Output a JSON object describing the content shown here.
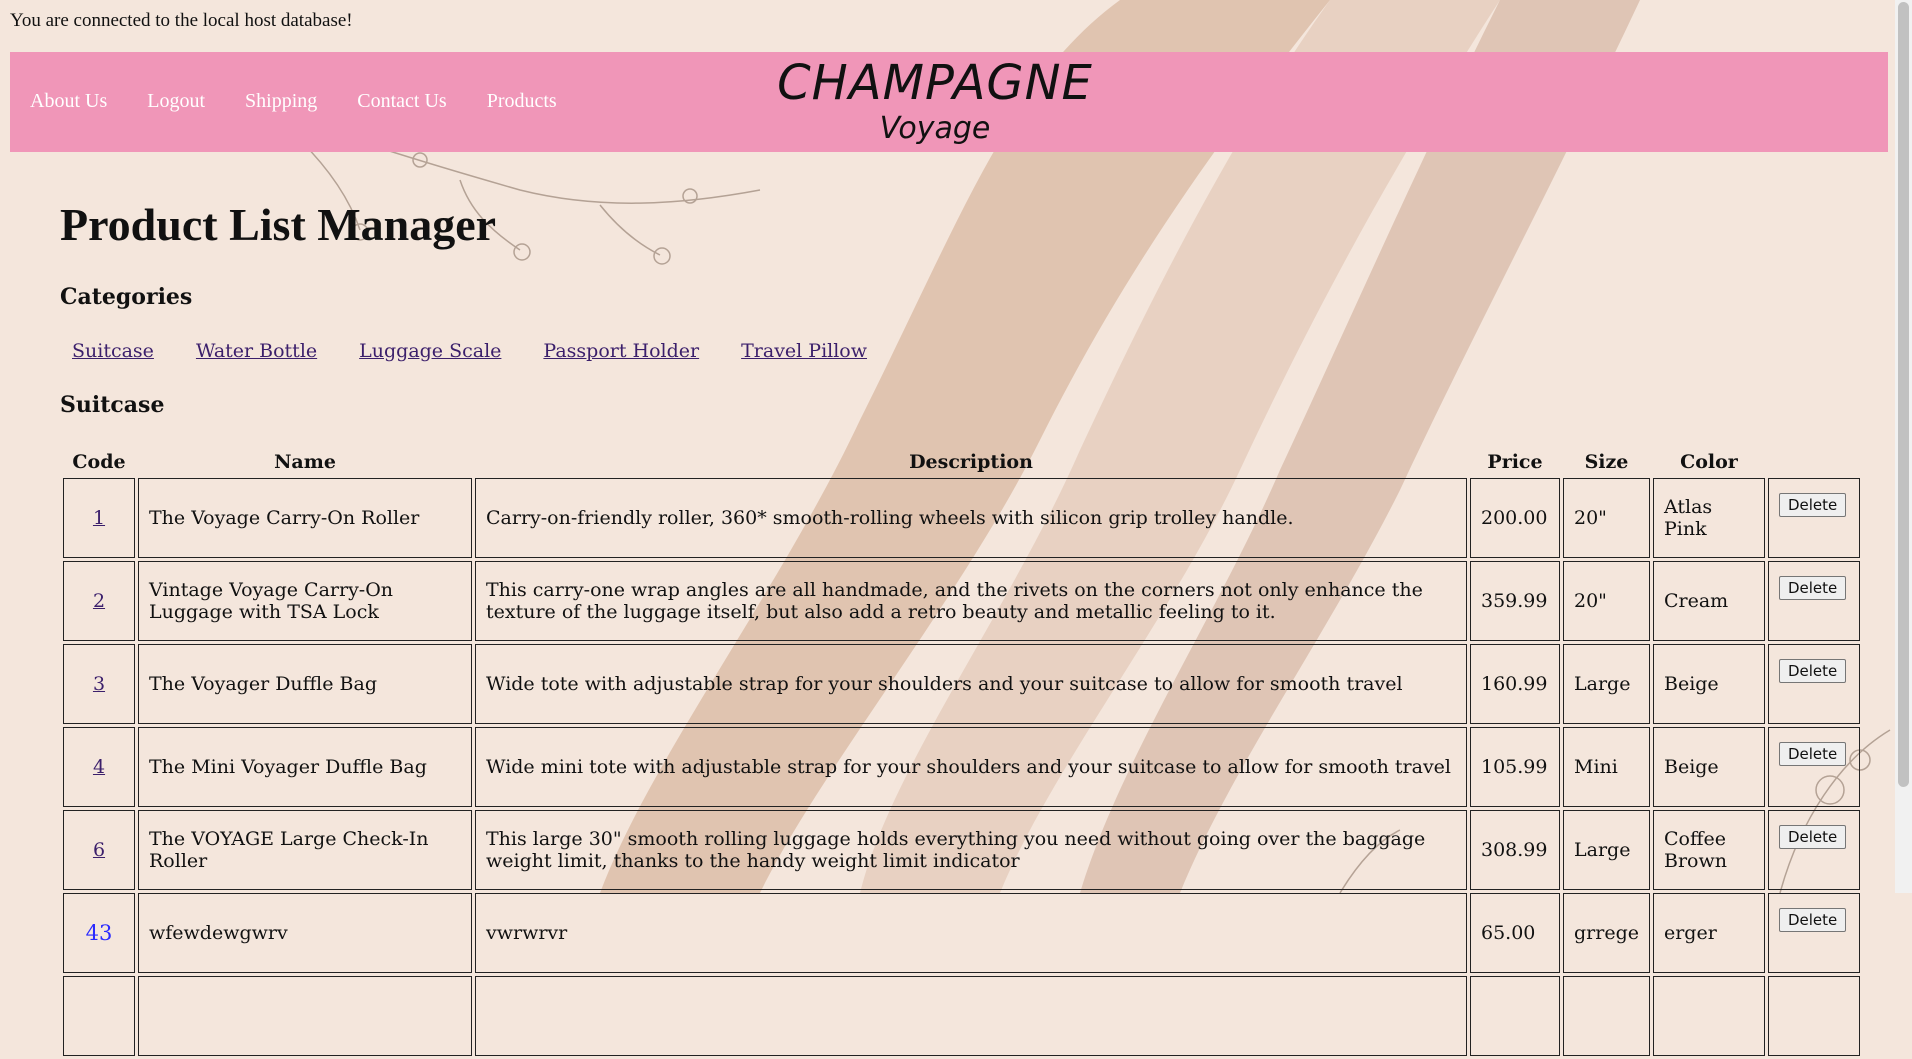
{
  "connection_message": "You are connected to the local host database!",
  "header": {
    "nav": [
      "About Us",
      "Logout",
      "Shipping",
      "Contact Us",
      "Products"
    ],
    "logo_main": "CHAMPAGNE",
    "logo_sub": "Voyage"
  },
  "page_title": "Product List Manager",
  "categories_heading": "Categories",
  "categories": [
    "Suitcase",
    "Water Bottle",
    "Luggage Scale",
    "Passport Holder",
    "Travel Pillow"
  ],
  "selected_category": "Suitcase",
  "table": {
    "headers": [
      "Code",
      "Name",
      "Description",
      "Price",
      "Size",
      "Color"
    ],
    "delete_label": "Delete",
    "rows": [
      {
        "code": "1",
        "name": "The Voyage Carry-On Roller",
        "description": "Carry-on-friendly roller, 360* smooth-rolling wheels with silicon grip trolley handle.",
        "price": "200.00",
        "size": "20\"",
        "color": "Atlas Pink"
      },
      {
        "code": "2",
        "name": "Vintage Voyage Carry-On Luggage with TSA Lock",
        "description": "This carry-one wrap angles are all handmade, and the rivets on the corners not only enhance the texture of the luggage itself, but also add a retro beauty and metallic feeling to it.",
        "price": "359.99",
        "size": "20\"",
        "color": "Cream"
      },
      {
        "code": "3",
        "name": "The Voyager Duffle Bag",
        "description": "Wide tote with adjustable strap for your shoulders and your suitcase to allow for smooth travel",
        "price": "160.99",
        "size": "Large",
        "color": "Beige"
      },
      {
        "code": "4",
        "name": "The Mini Voyager Duffle Bag",
        "description": "Wide mini tote with adjustable strap for your shoulders and your suitcase to allow for smooth travel",
        "price": "105.99",
        "size": "Mini",
        "color": "Beige"
      },
      {
        "code": "6",
        "name": "The VOYAGE Large Check-In Roller",
        "description": "This large 30\" smooth rolling luggage holds everything you need without going over the baggage weight limit, thanks to the handy weight limit indicator",
        "price": "308.99",
        "size": "Large",
        "color": "Coffee Brown"
      },
      {
        "code": "43",
        "name": "wfewdewgwrv",
        "description": "vwrwrvr",
        "price": "65.00",
        "size": "grrege",
        "color": "erger"
      }
    ]
  },
  "colors": {
    "header_bg": "#f096b8",
    "page_bg": "#f4e6dc",
    "link": "#3b1f6b"
  }
}
